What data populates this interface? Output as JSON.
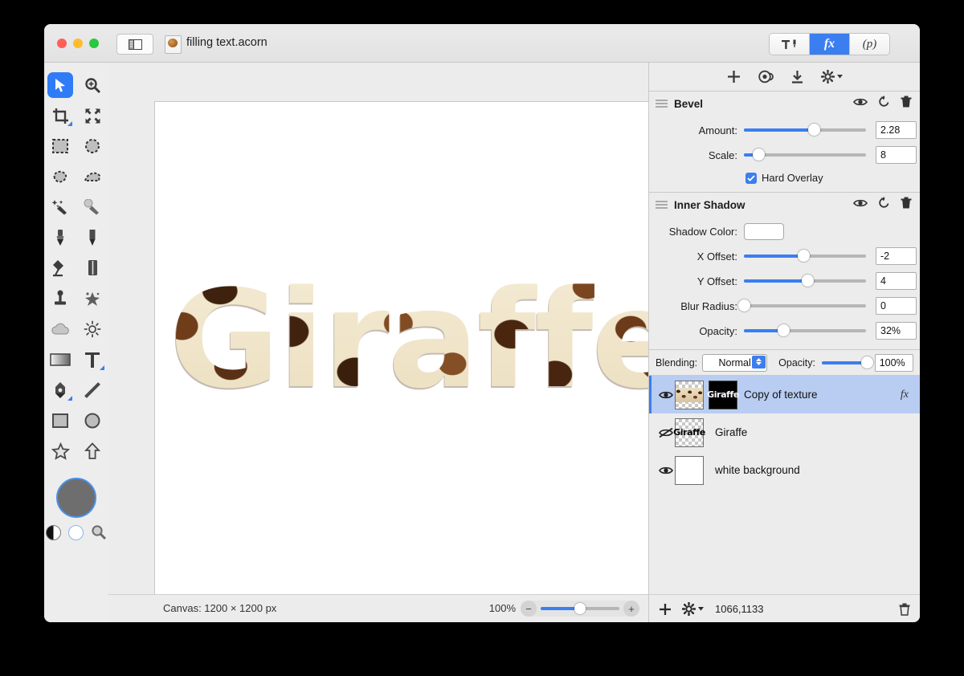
{
  "window": {
    "document_title": "filling text.acorn",
    "traffic_lights": [
      "close",
      "minimize",
      "zoom"
    ],
    "sidebar_toggle": "sidebar-toggle"
  },
  "segmented_control": {
    "items": [
      {
        "id": "tools",
        "label": "tools-icon",
        "active": false
      },
      {
        "id": "fx",
        "label": "fx",
        "active": true
      },
      {
        "id": "presets",
        "label": "(p)",
        "active": false
      }
    ]
  },
  "tools": {
    "items": [
      {
        "name": "move-tool",
        "selected": true
      },
      {
        "name": "zoom-tool",
        "selected": false
      },
      {
        "name": "crop-tool",
        "selected": false
      },
      {
        "name": "transform-tool",
        "selected": false
      },
      {
        "name": "rectangular-select-tool",
        "selected": false
      },
      {
        "name": "elliptical-select-tool",
        "selected": false
      },
      {
        "name": "lasso-select-tool",
        "selected": false
      },
      {
        "name": "polygon-select-tool",
        "selected": false
      },
      {
        "name": "magic-wand-tool",
        "selected": false
      },
      {
        "name": "instant-alpha-tool",
        "selected": false
      },
      {
        "name": "brush-tool",
        "selected": false
      },
      {
        "name": "pencil-tool",
        "selected": false
      },
      {
        "name": "paint-bucket-tool",
        "selected": false
      },
      {
        "name": "eraser-tool",
        "selected": false
      },
      {
        "name": "clone-stamp-tool",
        "selected": false
      },
      {
        "name": "smudge-tool",
        "selected": false
      },
      {
        "name": "blur-tool",
        "selected": false
      },
      {
        "name": "dodge-tool",
        "selected": false
      },
      {
        "name": "gradient-tool",
        "selected": false
      },
      {
        "name": "text-tool",
        "selected": false
      },
      {
        "name": "bezier-pen-tool",
        "selected": false
      },
      {
        "name": "line-tool",
        "selected": false
      },
      {
        "name": "rectangle-shape-tool",
        "selected": false
      },
      {
        "name": "oval-shape-tool",
        "selected": false
      },
      {
        "name": "star-shape-tool",
        "selected": false
      },
      {
        "name": "arrow-shape-tool",
        "selected": false
      }
    ],
    "color_well": "#6e6e6e"
  },
  "canvas": {
    "artwork_text": "Giraffe",
    "background": "#ffffff"
  },
  "statusbar": {
    "canvas_info": "Canvas: 1200 × 1200 px",
    "zoom_percent": "100%",
    "zoom_minus": "−",
    "zoom_plus": "+"
  },
  "fx_panel": {
    "toolbar": {
      "add": "add-effect-icon",
      "color": "color-palette-icon",
      "download": "download-icon",
      "gear": "gear-dropdown-icon"
    },
    "effects": [
      {
        "title": "Bevel",
        "controls": [
          {
            "type": "slider",
            "label": "Amount:",
            "value": "2.28",
            "fill_pct": 57
          },
          {
            "type": "slider",
            "label": "Scale:",
            "value": "8",
            "fill_pct": 12
          }
        ],
        "checkbox": {
          "label": "Hard Overlay",
          "checked": true
        }
      },
      {
        "title": "Inner Shadow",
        "color_label": "Shadow Color:",
        "color_value": "#ffffff",
        "controls": [
          {
            "type": "slider",
            "label": "X Offset:",
            "value": "-2",
            "fill_pct": 49
          },
          {
            "type": "slider",
            "label": "Y Offset:",
            "value": "4",
            "fill_pct": 52
          },
          {
            "type": "slider",
            "label": "Blur Radius:",
            "value": "0",
            "fill_pct": 0
          },
          {
            "type": "slider",
            "label": "Opacity:",
            "value": "32%",
            "fill_pct": 32
          }
        ]
      }
    ]
  },
  "layers_panel": {
    "blending_label": "Blending:",
    "blending_value": "Normal",
    "opacity_label": "Opacity:",
    "opacity_value": "100%",
    "opacity_fill_pct": 100,
    "layers": [
      {
        "name": "Copy of texture",
        "visible": true,
        "selected": true,
        "has_mask": true,
        "mask_text": "Giraffe",
        "fx": "fx"
      },
      {
        "name": "Giraffe",
        "visible": false,
        "selected": false,
        "thumb_text": "Giraffe"
      },
      {
        "name": "white background",
        "visible": true,
        "selected": false
      }
    ],
    "bottom": {
      "add": "add-layer-icon",
      "gear": "layer-actions-gear-icon",
      "coordinates": "1066,1133",
      "trash": "delete-layer-icon"
    }
  }
}
